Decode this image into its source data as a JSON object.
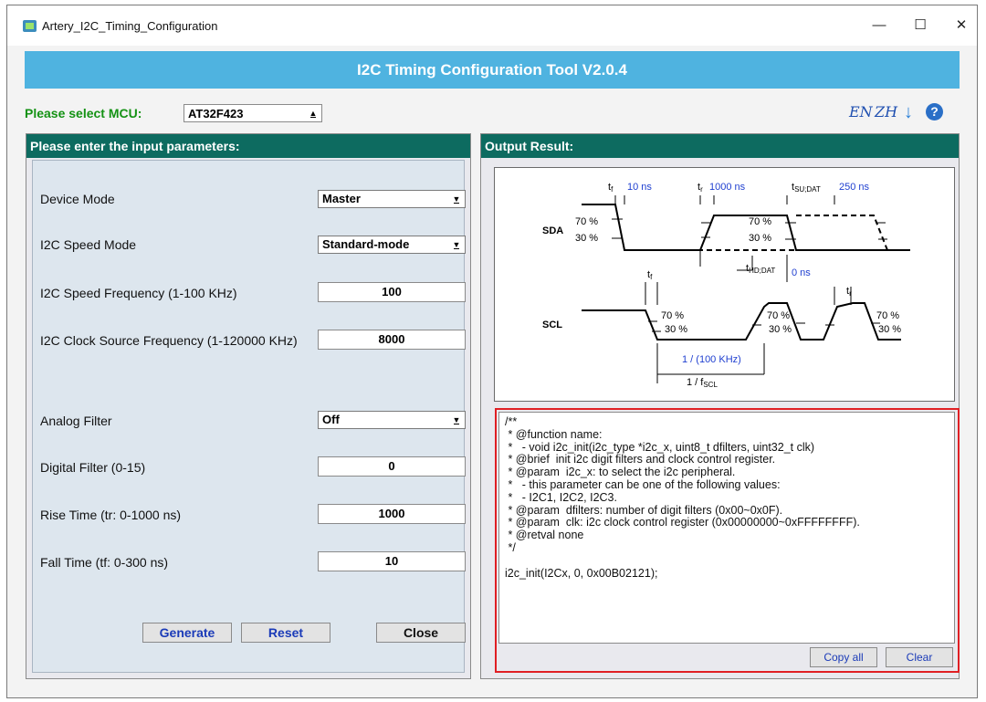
{
  "window": {
    "title": "Artery_I2C_Timing_Configuration",
    "min": "—",
    "max": "☐",
    "close": "✕"
  },
  "header": {
    "title": "I2C Timing Configuration Tool V2.0.4"
  },
  "mcu": {
    "label": "Please select MCU:",
    "value": "AT32F423"
  },
  "lang": {
    "en": "EN",
    "zh": "ZH"
  },
  "left_panel": {
    "title": "Please enter the input parameters:",
    "device_mode": {
      "label": "Device Mode",
      "value": "Master"
    },
    "speed_mode": {
      "label": "I2C Speed Mode",
      "value": "Standard-mode"
    },
    "speed_freq": {
      "label": "I2C Speed Frequency (1-100 KHz)",
      "value": "100"
    },
    "clock_freq": {
      "label": "I2C Clock Source Frequency (1-120000 KHz)",
      "value": "8000"
    },
    "analog_filter": {
      "label": "Analog Filter",
      "value": "Off"
    },
    "digital_filter": {
      "label": "Digital Filter (0-15)",
      "value": "0"
    },
    "rise_time": {
      "label": "Rise Time (tr: 0-1000 ns)",
      "value": "1000"
    },
    "fall_time": {
      "label": "Fall Time (tf: 0-300 ns)",
      "value": "10"
    },
    "buttons": {
      "generate": "Generate",
      "reset": "Reset",
      "close": "Close"
    }
  },
  "right_panel": {
    "title": "Output Result:",
    "diagram": {
      "tf_label": "t",
      "tf_sub": "f",
      "tf_value": "10 ns",
      "tr_label": "t",
      "tr_sub": "r",
      "tr_value": "1000 ns",
      "tsu_label": "t",
      "tsu_sub": "SU;DAT",
      "tsu_value": "250 ns",
      "thd_label": "t",
      "thd_sub": "HD;DAT",
      "thd_value": "0 ns",
      "sda": "SDA",
      "scl": "SCL",
      "p70": "70 %",
      "p30": "30 %",
      "period": "1 / (100 KHz)",
      "fscl_prefix": "1 / f",
      "fscl_sub": "SCL"
    },
    "code": "/**\n * @function name:\n *   - void i2c_init(i2c_type *i2c_x, uint8_t dfilters, uint32_t clk)\n * @brief  init i2c digit filters and clock control register.\n * @param  i2c_x: to select the i2c peripheral.\n *   - this parameter can be one of the following values:\n *   - I2C1, I2C2, I2C3.\n * @param  dfilters: number of digit filters (0x00~0x0F).\n * @param  clk: i2c clock control register (0x00000000~0xFFFFFFFF).\n * @retval none\n */\n\ni2c_init(I2Cx, 0, 0x00B02121);",
    "buttons": {
      "copy_all": "Copy all",
      "clear": "Clear"
    }
  },
  "colors": {
    "header": "#4fb3e0",
    "panel_head": "#0d6b60",
    "mcu_label": "#149214",
    "highlight": "#e01f24",
    "blue_text": "#1b3bb8"
  }
}
